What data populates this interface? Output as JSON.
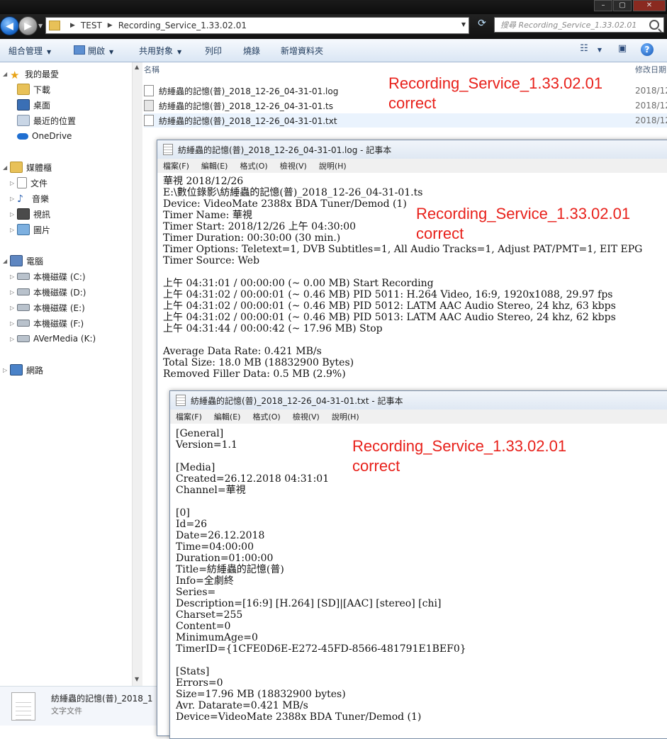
{
  "explorer": {
    "breadcrumb": [
      "TEST",
      "Recording_Service_1.33.02.01"
    ],
    "search_placeholder": "搜尋 Recording_Service_1.33.02.01",
    "toolbar": {
      "organize": "組合管理",
      "open": "開啟",
      "share": "共用對象",
      "print": "列印",
      "burn": "燒錄",
      "new_folder": "新增資料夾"
    },
    "nav": {
      "favorites": "我的最愛",
      "downloads": "下載",
      "desktop": "桌面",
      "recent": "最近的位置",
      "onedrive": "OneDrive",
      "libraries": "媒體櫃",
      "documents": "文件",
      "music": "音樂",
      "videos": "視訊",
      "pictures": "圖片",
      "computer": "電腦",
      "drive_c": "本機磁碟 (C:)",
      "drive_d": "本機磁碟 (D:)",
      "drive_e": "本機磁碟 (E:)",
      "drive_f": "本機磁碟 (F:)",
      "drive_k": "AVerMedia (K:)",
      "network": "網路"
    },
    "columns": {
      "name": "名稱",
      "modified": "修改日期"
    },
    "files": [
      {
        "name": "紡綞蟲的記憶(普)_2018_12-26_04-31-01.log",
        "date": "2018/12"
      },
      {
        "name": "紡綞蟲的記憶(普)_2018_12-26_04-31-01.ts",
        "date": "2018/12"
      },
      {
        "name": "紡綞蟲的記憶(普)_2018_12-26_04-31-01.txt",
        "date": "2018/12"
      }
    ],
    "status": {
      "name": "紡綞蟲的記憶(普)_2018_1",
      "type": "文字文件"
    }
  },
  "annotations": {
    "line1": "Recording_Service_1.33.02.01",
    "line2": "correct"
  },
  "notepad_log": {
    "title": "紡綞蟲的記憶(普)_2018_12-26_04-31-01.log - 記事本",
    "menu": [
      "檔案(F)",
      "編輯(E)",
      "格式(O)",
      "檢視(V)",
      "說明(H)"
    ],
    "lines": [
      "華視 2018/12/26",
      "E:\\數位錄影\\紡綞蟲的記憶(普)_2018_12-26_04-31-01.ts",
      "Device: VideoMate 2388x BDA Tuner/Demod (1)",
      "Timer Name: 華視",
      "Timer Start: 2018/12/26 上午 04:30:00",
      "Timer Duration: 00:30:00 (30 min.)",
      "Timer Options: Teletext=1, DVB Subtitles=1, All Audio Tracks=1, Adjust PAT/PMT=1, EIT EPG",
      "Timer Source: Web",
      "",
      "上午 04:31:01 / 00:00:00 (~ 0.00 MB) Start Recording",
      "上午 04:31:02 / 00:00:01 (~ 0.46 MB) PID 5011: H.264 Video, 16:9, 1920x1088, 29.97 fps",
      "上午 04:31:02 / 00:00:01 (~ 0.46 MB) PID 5012: LATM AAC Audio Stereo, 24 khz, 63 kbps",
      "上午 04:31:02 / 00:00:01 (~ 0.46 MB) PID 5013: LATM AAC Audio Stereo, 24 khz, 62 kbps",
      "上午 04:31:44 / 00:00:42 (~ 17.96 MB) Stop",
      "",
      "Average Data Rate: 0.421 MB/s",
      "Total Size: 18.0 MB (18832900 Bytes)",
      "Removed Filler Data: 0.5 MB (2.9%)"
    ]
  },
  "notepad_txt": {
    "title": "紡綞蟲的記憶(普)_2018_12-26_04-31-01.txt - 記事本",
    "menu": [
      "檔案(F)",
      "編輯(E)",
      "格式(O)",
      "檢視(V)",
      "說明(H)"
    ],
    "lines": [
      "[General]",
      "Version=1.1",
      "",
      "[Media]",
      "Created=26.12.2018 04:31:01",
      "Channel=華視",
      "",
      "[0]",
      "Id=26",
      "Date=26.12.2018",
      "Time=04:00:00",
      "Duration=01:00:00",
      "Title=紡綞蟲的記憶(普)",
      "Info=全劇終",
      "Series=",
      "Description=[16:9] [H.264] [SD]|[AAC] [stereo] [chi]",
      "Charset=255",
      "Content=0",
      "MinimumAge=0",
      "TimerID={1CFE0D6E-E272-45FD-8566-481791E1BEF0}",
      "",
      "[Stats]",
      "Errors=0",
      "Size=17.96 MB (18832900 bytes)",
      "Avr. Datarate=0.421 MB/s",
      "Device=VideoMate 2388x BDA Tuner/Demod (1)"
    ]
  }
}
